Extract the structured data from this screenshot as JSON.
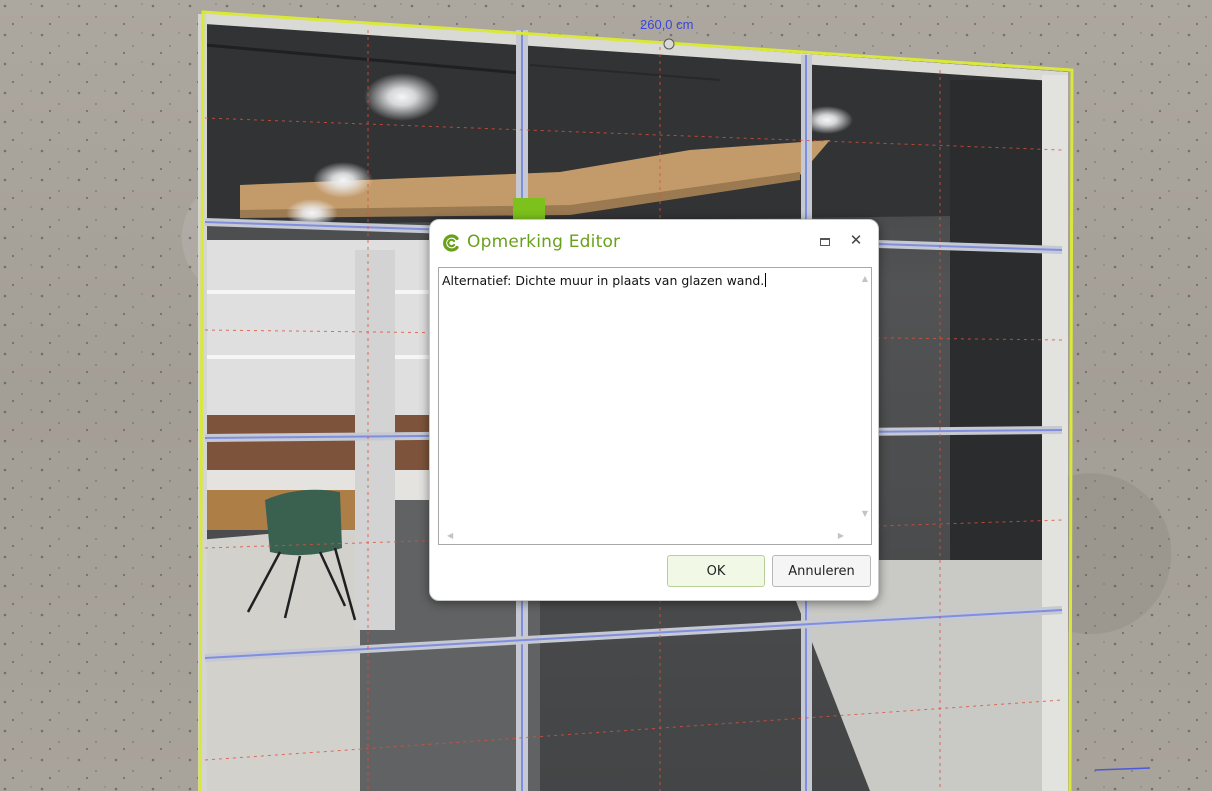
{
  "viewport": {
    "dimension_label": "260,0 cm",
    "colors": {
      "selection_outline": "#d9e83a",
      "mullion": "#7f8fe0",
      "guide_line": "#e0503a",
      "dimension_text": "#3a46d8"
    }
  },
  "dialog": {
    "title": "Opmerking Editor",
    "icon": "app-logo-icon",
    "maximize_icon": "maximize-icon",
    "close_icon": "close-icon",
    "close_glyph": "✕",
    "text_value": "Alternatief: Dichte muur in plaats van glazen wand.",
    "ok_label": "OK",
    "cancel_label": "Annuleren",
    "title_color": "#6aa11b"
  }
}
